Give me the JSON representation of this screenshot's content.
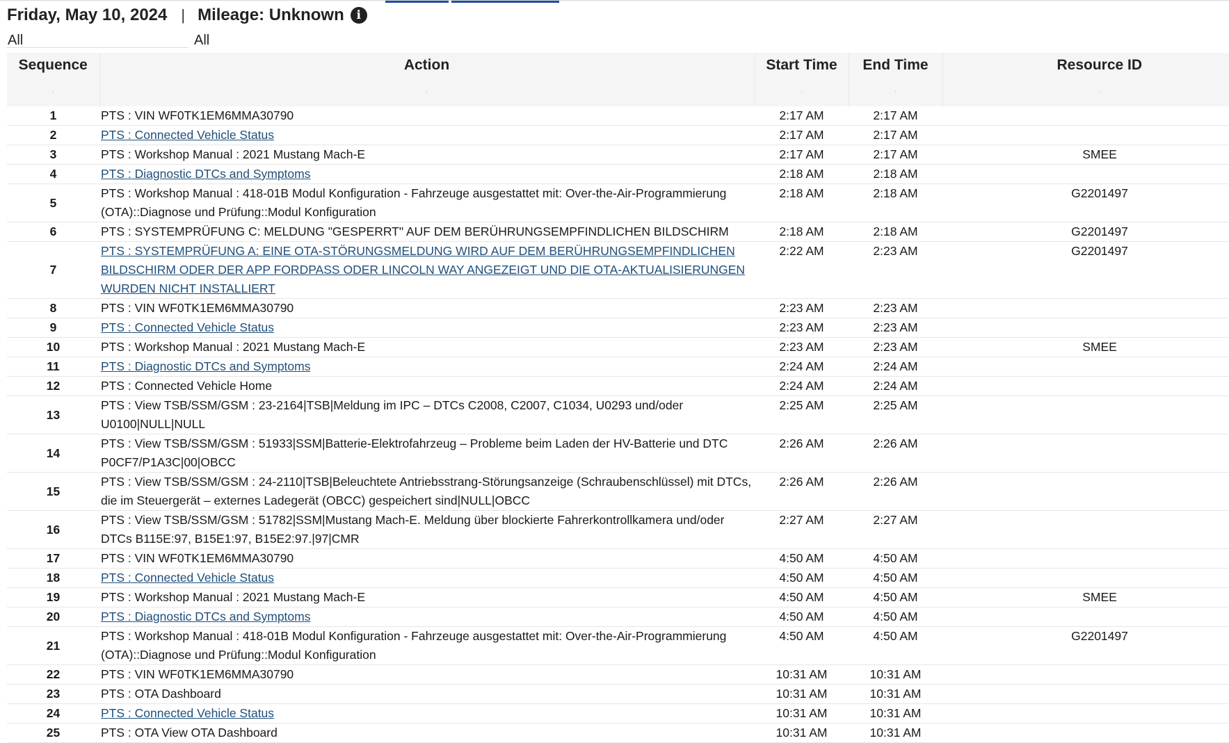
{
  "header": {
    "date": "Friday, May 10, 2024",
    "separator": "|",
    "mileage": "Mileage: Unknown",
    "info_icon": "info-icon"
  },
  "filters": {
    "first_value": "All",
    "second_value": "All"
  },
  "table": {
    "columns": {
      "sequence": "Sequence",
      "action": "Action",
      "start_time": "Start Time",
      "end_time": "End Time",
      "resource_id": "Resource ID"
    },
    "rows": [
      {
        "seq": "1",
        "action": "PTS : VIN WF0TK1EM6MMA30790",
        "link": false,
        "start": "2:17 AM",
        "end": "2:17 AM",
        "res": ""
      },
      {
        "seq": "2",
        "action": "PTS : Connected Vehicle Status",
        "link": true,
        "start": "2:17 AM",
        "end": "2:17 AM",
        "res": ""
      },
      {
        "seq": "3",
        "action": "PTS : Workshop Manual : 2021 Mustang Mach-E",
        "link": false,
        "start": "2:17 AM",
        "end": "2:17 AM",
        "res": "SMEE"
      },
      {
        "seq": "4",
        "action": "PTS : Diagnostic DTCs and Symptoms",
        "link": true,
        "start": "2:18 AM",
        "end": "2:18 AM",
        "res": ""
      },
      {
        "seq": "5",
        "action": "PTS : Workshop Manual : 418-01B Modul Konfiguration - Fahrzeuge ausgestattet mit: Over-the-Air-Programmierung (OTA)::Diagnose und Prüfung::Modul Konfiguration",
        "link": false,
        "start": "2:18 AM",
        "end": "2:18 AM",
        "res": "G2201497"
      },
      {
        "seq": "6",
        "action": "PTS : SYSTEMPRÜFUNG C: MELDUNG \"GESPERRT\" AUF DEM BERÜHRUNGSEMPFINDLICHEN BILDSCHIRM",
        "link": false,
        "start": "2:18 AM",
        "end": "2:18 AM",
        "res": "G2201497"
      },
      {
        "seq": "7",
        "action": "PTS : SYSTEMPRÜFUNG A: EINE OTA-STÖRUNGSMELDUNG WIRD AUF DEM BERÜHRUNGSEMPFINDLICHEN BILDSCHIRM ODER DER APP FORDPASS ODER LINCOLN WAY ANGEZEIGT UND DIE OTA-AKTUALISIERUNGEN WURDEN NICHT INSTALLIERT",
        "link": true,
        "start": "2:22 AM",
        "end": "2:23 AM",
        "res": "G2201497"
      },
      {
        "seq": "8",
        "action": "PTS : VIN WF0TK1EM6MMA30790",
        "link": false,
        "start": "2:23 AM",
        "end": "2:23 AM",
        "res": ""
      },
      {
        "seq": "9",
        "action": "PTS : Connected Vehicle Status",
        "link": true,
        "start": "2:23 AM",
        "end": "2:23 AM",
        "res": ""
      },
      {
        "seq": "10",
        "action": "PTS : Workshop Manual : 2021 Mustang Mach-E",
        "link": false,
        "start": "2:23 AM",
        "end": "2:23 AM",
        "res": "SMEE"
      },
      {
        "seq": "11",
        "action": "PTS : Diagnostic DTCs and Symptoms",
        "link": true,
        "start": "2:24 AM",
        "end": "2:24 AM",
        "res": ""
      },
      {
        "seq": "12",
        "action": "PTS : Connected Vehicle Home",
        "link": false,
        "start": "2:24 AM",
        "end": "2:24 AM",
        "res": ""
      },
      {
        "seq": "13",
        "action": "PTS : View TSB/SSM/GSM : 23-2164|TSB|Meldung im IPC – DTCs C2008, C2007, C1034, U0293 und/oder U0100|NULL|NULL",
        "link": false,
        "start": "2:25 AM",
        "end": "2:25 AM",
        "res": ""
      },
      {
        "seq": "14",
        "action": "PTS : View TSB/SSM/GSM : 51933|SSM|Batterie-Elektrofahrzeug – Probleme beim Laden der HV-Batterie und DTC P0CF7/P1A3C|00|OBCC",
        "link": false,
        "start": "2:26 AM",
        "end": "2:26 AM",
        "res": ""
      },
      {
        "seq": "15",
        "action": "PTS : View TSB/SSM/GSM : 24-2110|TSB|Beleuchtete Antriebsstrang-Störungsanzeige (Schraubenschlüssel) mit DTCs, die im Steuergerät – externes Ladegerät (OBCC) gespeichert sind|NULL|OBCC",
        "link": false,
        "start": "2:26 AM",
        "end": "2:26 AM",
        "res": ""
      },
      {
        "seq": "16",
        "action": "PTS : View TSB/SSM/GSM : 51782|SSM|Mustang Mach-E. Meldung über blockierte Fahrerkontrollkamera und/oder DTCs B115E:97, B15E1:97, B15E2:97.|97|CMR",
        "link": false,
        "start": "2:27 AM",
        "end": "2:27 AM",
        "res": ""
      },
      {
        "seq": "17",
        "action": "PTS : VIN WF0TK1EM6MMA30790",
        "link": false,
        "start": "4:50 AM",
        "end": "4:50 AM",
        "res": ""
      },
      {
        "seq": "18",
        "action": "PTS : Connected Vehicle Status",
        "link": true,
        "start": "4:50 AM",
        "end": "4:50 AM",
        "res": ""
      },
      {
        "seq": "19",
        "action": "PTS : Workshop Manual : 2021 Mustang Mach-E",
        "link": false,
        "start": "4:50 AM",
        "end": "4:50 AM",
        "res": "SMEE"
      },
      {
        "seq": "20",
        "action": "PTS : Diagnostic DTCs and Symptoms",
        "link": true,
        "start": "4:50 AM",
        "end": "4:50 AM",
        "res": ""
      },
      {
        "seq": "21",
        "action": "PTS : Workshop Manual : 418-01B Modul Konfiguration - Fahrzeuge ausgestattet mit: Over-the-Air-Programmierung (OTA)::Diagnose und Prüfung::Modul Konfiguration",
        "link": false,
        "start": "4:50 AM",
        "end": "4:50 AM",
        "res": "G2201497"
      },
      {
        "seq": "22",
        "action": "PTS : VIN WF0TK1EM6MMA30790",
        "link": false,
        "start": "10:31 AM",
        "end": "10:31 AM",
        "res": ""
      },
      {
        "seq": "23",
        "action": "PTS : OTA Dashboard",
        "link": false,
        "start": "10:31 AM",
        "end": "10:31 AM",
        "res": ""
      },
      {
        "seq": "24",
        "action": "PTS : Connected Vehicle Status",
        "link": true,
        "start": "10:31 AM",
        "end": "10:31 AM",
        "res": ""
      },
      {
        "seq": "25",
        "action": "PTS : OTA View OTA Dashboard",
        "link": false,
        "start": "10:31 AM",
        "end": "10:31 AM",
        "res": ""
      }
    ]
  },
  "colors": {
    "link": "#1f4f7a",
    "header_bg": "#f5f5f5",
    "tab_accent": "#1f4f9a"
  }
}
